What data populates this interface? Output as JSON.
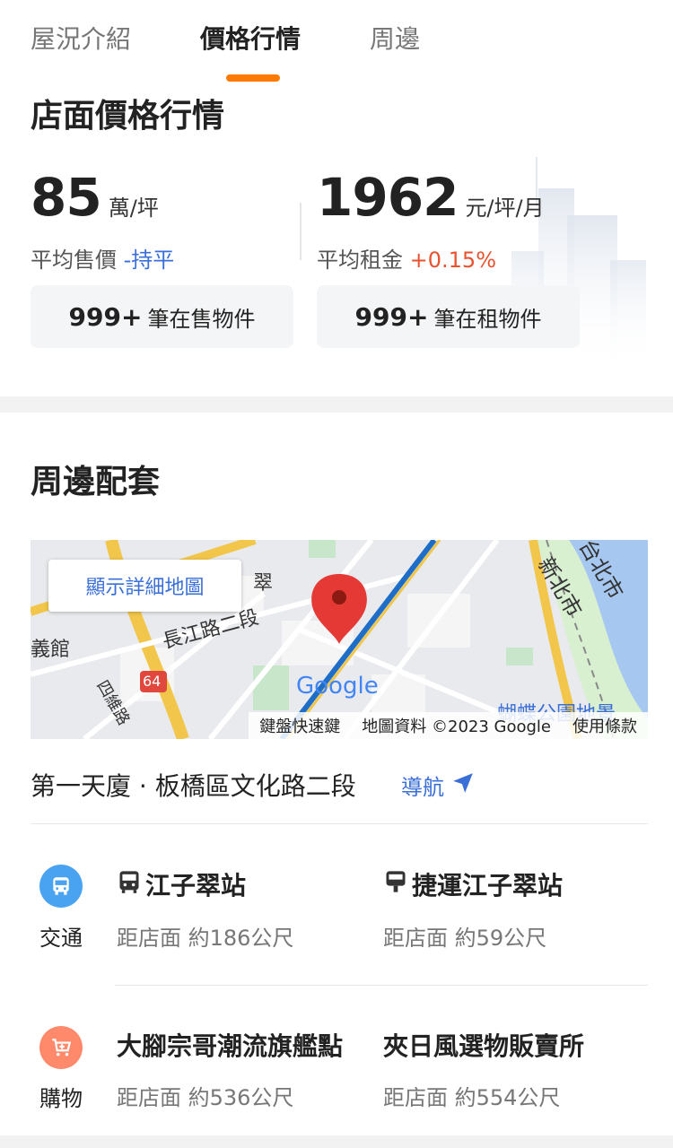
{
  "tabs": [
    {
      "label": "屋況介紹",
      "active": false
    },
    {
      "label": "價格行情",
      "active": true
    },
    {
      "label": "周邊",
      "active": false
    }
  ],
  "accent_color": "#ff7a00",
  "price": {
    "title": "店面價格行情",
    "sale": {
      "value": "85",
      "unit": "萬/坪",
      "label": "平均售價",
      "trend": "-持平",
      "count_num": "999+",
      "count_text": "筆在售物件"
    },
    "rent": {
      "value": "1962",
      "unit": "元/坪/月",
      "label": "平均租金",
      "trend": "+0.15%",
      "count_num": "999+",
      "count_text": "筆在租物件"
    }
  },
  "nearby": {
    "title": "周邊配套",
    "map": {
      "button": "顯示詳細地圖",
      "footer": [
        "鍵盤快速鍵",
        "地圖資料 ©2023 Google",
        "使用條款"
      ],
      "labels": {
        "road": "長江路二段",
        "city": "新北市",
        "city2": "台北市",
        "place": "翠",
        "hall": "義館",
        "road2": "四維路",
        "route": "64",
        "park": "蝴蝶公園地景",
        "logo": "Google"
      }
    },
    "address": "第一天廈 · 板橋區文化路二段",
    "navigate": "導航",
    "categories": [
      {
        "label": "交通",
        "icon": "bus-icon",
        "color": "#4aa3f0",
        "places": [
          {
            "name": "江子翠站",
            "icon": "bus-icon",
            "distance": "距店面 約186公尺"
          },
          {
            "name": "捷運江子翠站",
            "icon": "metro-icon",
            "distance": "距店面 約59公尺"
          }
        ]
      },
      {
        "label": "購物",
        "icon": "shopping-cart-icon",
        "color": "#ff8a6b",
        "places": [
          {
            "name": "大腳宗哥潮流旗艦點",
            "icon": "",
            "distance": "距店面 約536公尺"
          },
          {
            "name": "夾日風選物販賣所",
            "icon": "",
            "distance": "距店面 約554公尺"
          }
        ]
      }
    ]
  }
}
